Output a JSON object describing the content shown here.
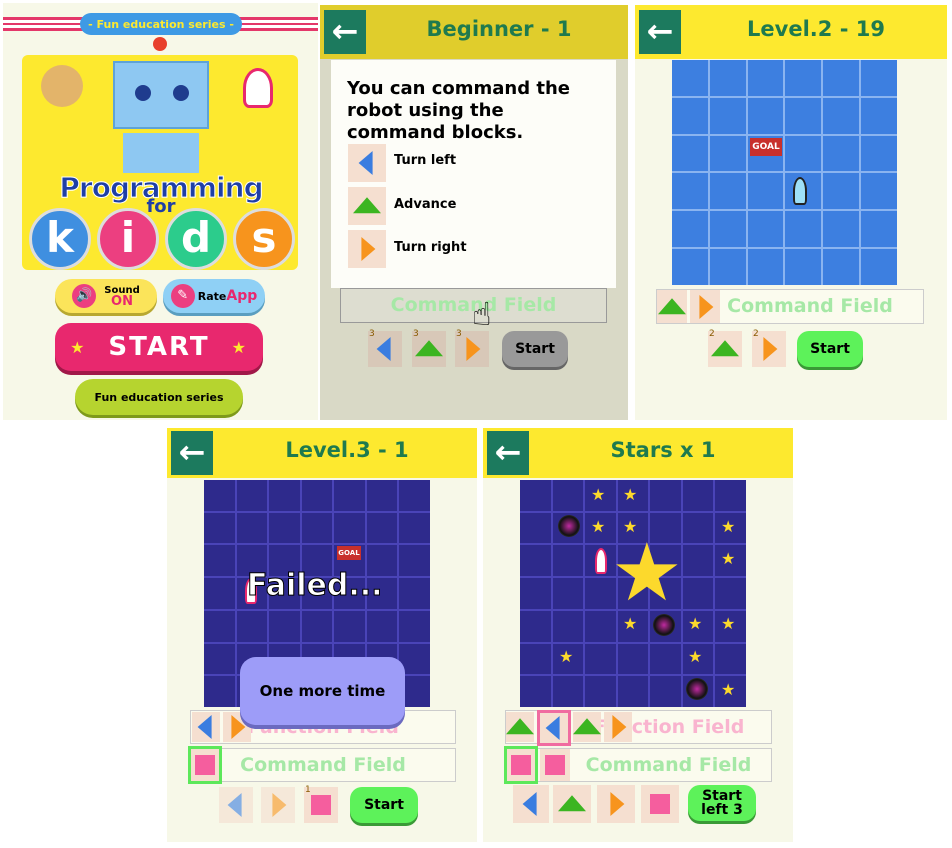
{
  "title_screen": {
    "series_banner": "- Fun education series -",
    "logo_text": "Programming for kids",
    "logo_line1": "Programming",
    "logo_line2": "for",
    "logo_letters": [
      "k",
      "i",
      "d",
      "s"
    ],
    "sound_label": "Sound",
    "sound_state": "ON",
    "rate_label_1": "Rate",
    "rate_label_2": "App",
    "start_label": "START",
    "series_button": "Fun education series"
  },
  "beginner": {
    "title": "Beginner - 1",
    "tutorial_text": "You can command the robot using the command blocks.",
    "commands": [
      {
        "icon": "turn-left",
        "label": "Turn left"
      },
      {
        "icon": "advance",
        "label": "Advance"
      },
      {
        "icon": "turn-right",
        "label": "Turn right"
      }
    ],
    "command_field": "Command Field",
    "block_counts": [
      "3",
      "3",
      "3"
    ],
    "start_label": "Start"
  },
  "level2": {
    "title": "Level.2 - 19",
    "goal_label": "GOAL",
    "command_field": "Command Field",
    "block_counts": [
      "2",
      "2"
    ],
    "start_label": "Start"
  },
  "level3": {
    "title": "Level.3 - 1",
    "goal_label": "GOAL",
    "failed_text": "Failed...",
    "dialog_button": "One more time",
    "function_field": "Function Field",
    "command_field": "Command Field",
    "block_counts": [
      "1"
    ],
    "start_label": "Start"
  },
  "stars": {
    "title": "Stars x 1",
    "function_field": "Function Field",
    "command_field": "Command Field",
    "start_label_1": "Start",
    "start_label_2": "left 3"
  },
  "colors": {
    "header": "#fde92f",
    "back_button": "#1c7a5e",
    "title_text": "#1f7a4e",
    "water": "#3d7fe0",
    "space": "#2e2a8c",
    "start_green": "#5df25a",
    "start_pink": "#e8286e"
  }
}
